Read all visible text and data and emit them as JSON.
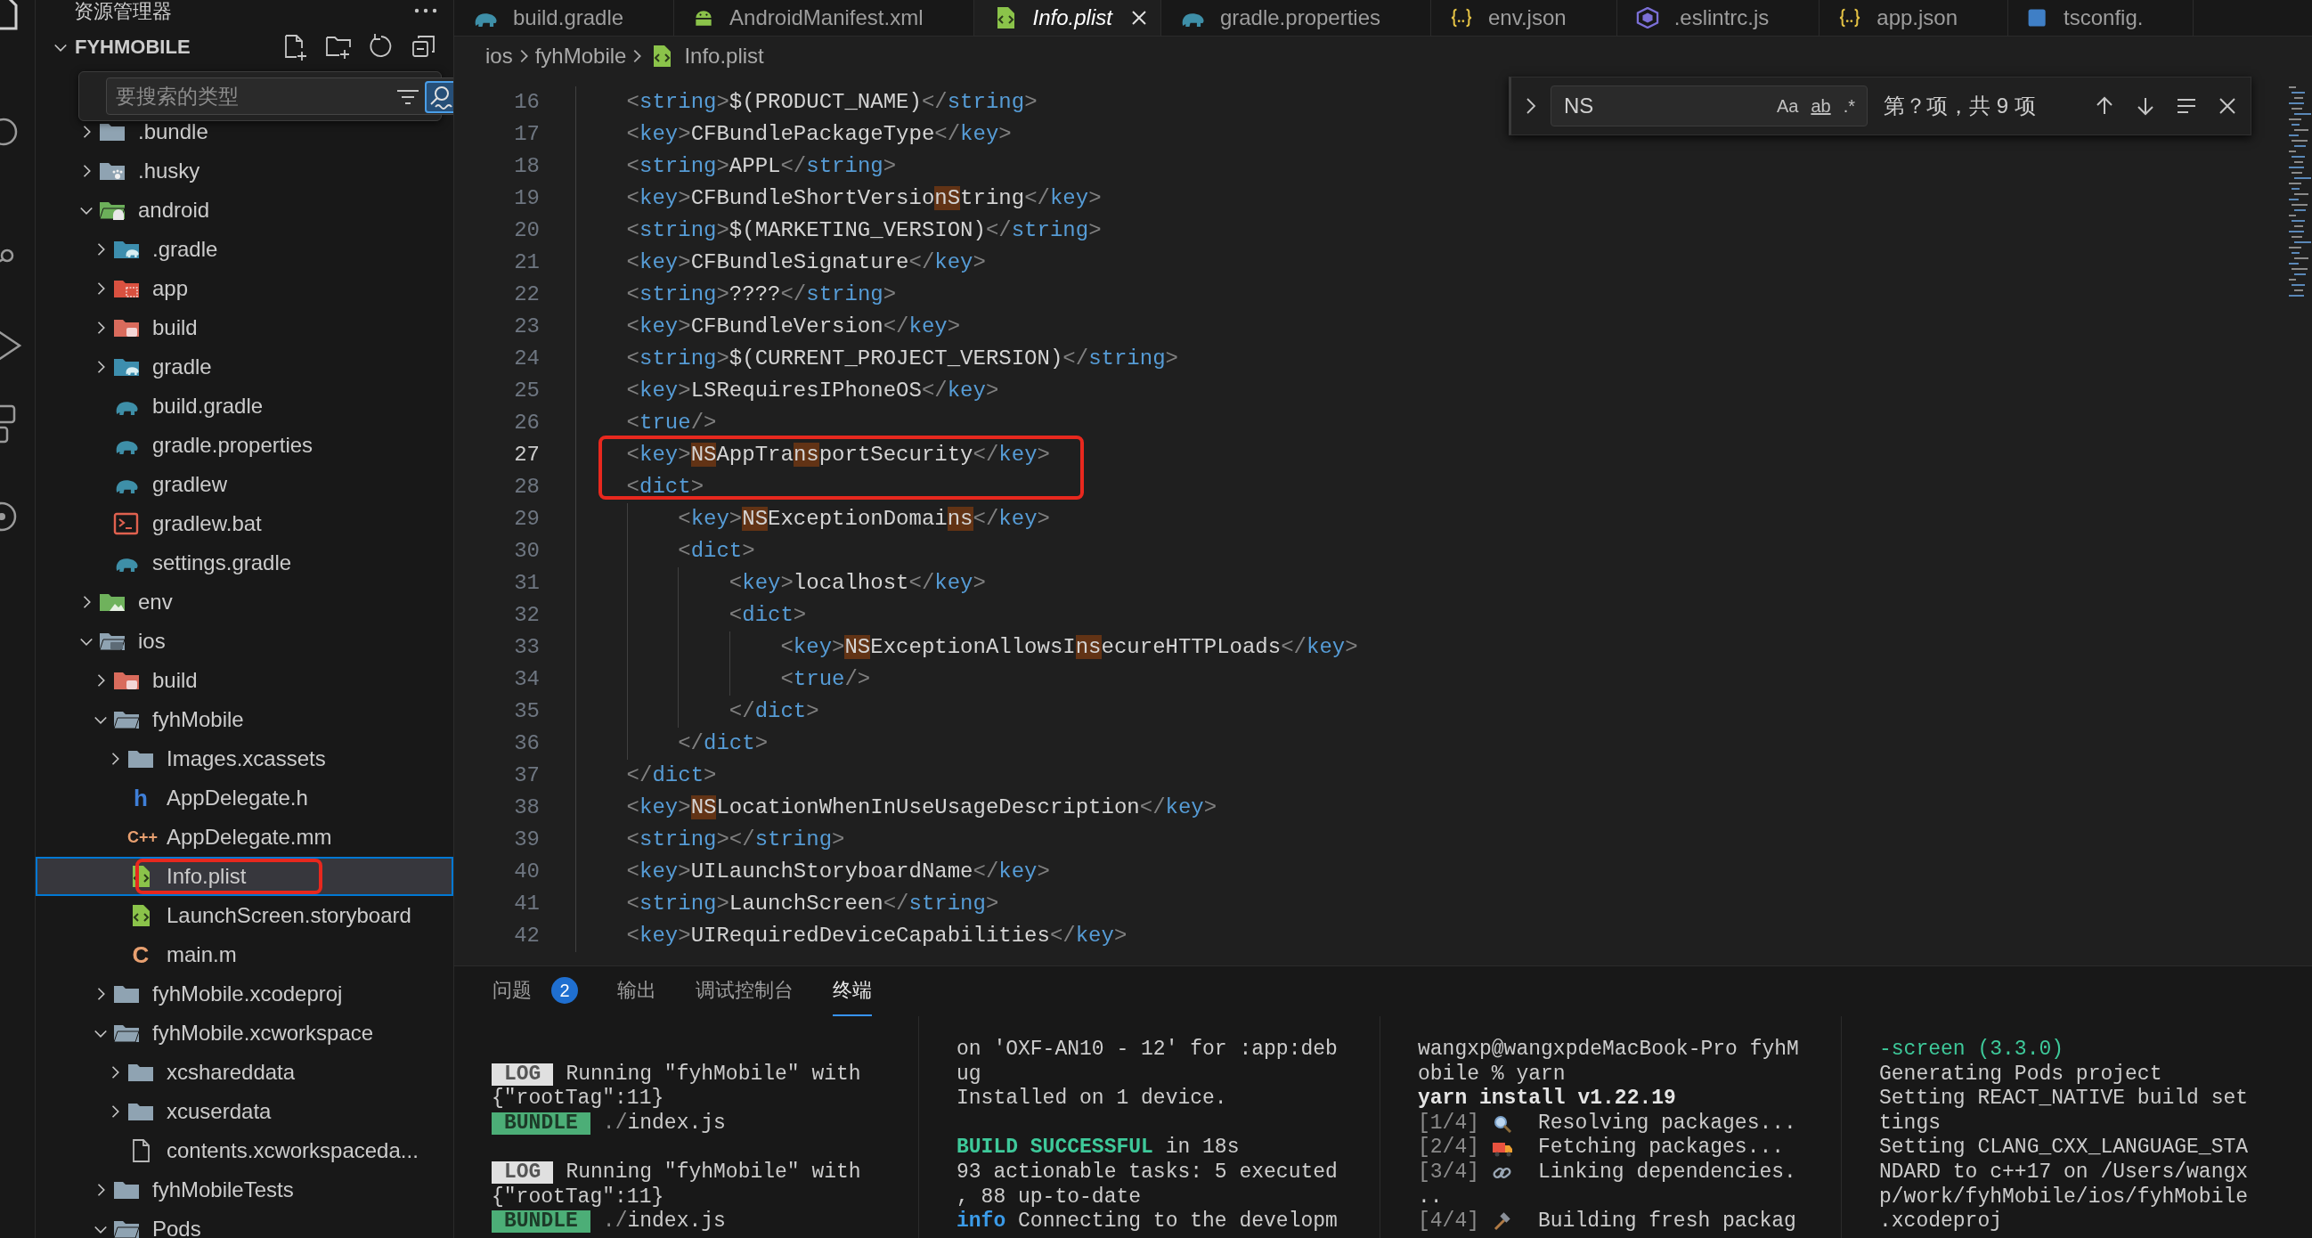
{
  "sidebar": {
    "title": "资源管理器",
    "root": {
      "label": "FYHMOBILE",
      "expanded": true
    },
    "type_filter": {
      "placeholder": "要搜索的类型",
      "fuzzy": true
    },
    "tree": [
      {
        "label": ".bundle",
        "kind": "folder",
        "expanded": false,
        "selected": false,
        "boxed": false
      },
      {
        "label": ".husky",
        "kind": "folder-husky",
        "expanded": false,
        "selected": false,
        "boxed": false
      },
      {
        "label": "android",
        "kind": "folder-android",
        "expanded": true,
        "selected": false,
        "boxed": false,
        "children": [
          {
            "label": ".gradle",
            "kind": "folder-gradle",
            "expanded": false,
            "selected": false,
            "boxed": false
          },
          {
            "label": "app",
            "kind": "folder-app",
            "expanded": false,
            "selected": false,
            "boxed": false
          },
          {
            "label": "build",
            "kind": "folder-build",
            "expanded": false,
            "selected": false,
            "boxed": false
          },
          {
            "label": "gradle",
            "kind": "folder-gradle",
            "expanded": false,
            "selected": false,
            "boxed": false
          },
          {
            "label": "build.gradle",
            "kind": "gradle",
            "selected": false,
            "boxed": false
          },
          {
            "label": "gradle.properties",
            "kind": "gradle",
            "selected": false,
            "boxed": false
          },
          {
            "label": "gradlew",
            "kind": "gradle",
            "selected": false,
            "boxed": false
          },
          {
            "label": "gradlew.bat",
            "kind": "bat",
            "selected": false,
            "boxed": false
          },
          {
            "label": "settings.gradle",
            "kind": "gradle",
            "selected": false,
            "boxed": false
          }
        ]
      },
      {
        "label": "env",
        "kind": "folder-env",
        "expanded": false,
        "selected": false,
        "boxed": false
      },
      {
        "label": "ios",
        "kind": "folder-ios",
        "expanded": true,
        "selected": false,
        "boxed": false,
        "children": [
          {
            "label": "build",
            "kind": "folder-build",
            "expanded": false,
            "selected": false,
            "boxed": false
          },
          {
            "label": "fyhMobile",
            "kind": "folder",
            "expanded": true,
            "selected": false,
            "boxed": false,
            "children": [
              {
                "label": "Images.xcassets",
                "kind": "folder",
                "expanded": false,
                "selected": false,
                "boxed": false
              },
              {
                "label": "AppDelegate.h",
                "kind": "glyph-h",
                "glyph": "h",
                "selected": false,
                "boxed": false
              },
              {
                "label": "AppDelegate.mm",
                "kind": "glyph-cpp",
                "glyph": "C++",
                "selected": false,
                "boxed": false
              },
              {
                "label": "Info.plist",
                "kind": "xml",
                "selected": true,
                "boxed": true
              },
              {
                "label": "LaunchScreen.storyboard",
                "kind": "xml",
                "selected": false,
                "boxed": false
              },
              {
                "label": "main.m",
                "kind": "glyph-c",
                "glyph": "C",
                "selected": false,
                "boxed": false
              }
            ]
          },
          {
            "label": "fyhMobile.xcodeproj",
            "kind": "folder",
            "expanded": false,
            "selected": false,
            "boxed": false
          },
          {
            "label": "fyhMobile.xcworkspace",
            "kind": "folder",
            "expanded": true,
            "selected": false,
            "boxed": false,
            "children": [
              {
                "label": "xcshareddata",
                "kind": "folder",
                "expanded": false,
                "selected": false,
                "boxed": false
              },
              {
                "label": "xcuserdata",
                "kind": "folder",
                "expanded": false,
                "selected": false,
                "boxed": false
              },
              {
                "label": "contents.xcworkspaceda...",
                "kind": "file",
                "selected": false,
                "boxed": false
              }
            ]
          },
          {
            "label": "fyhMobileTests",
            "kind": "folder",
            "expanded": false,
            "selected": false,
            "boxed": false
          },
          {
            "label": "Pods",
            "kind": "folder",
            "expanded": true,
            "selected": false,
            "boxed": false
          }
        ]
      }
    ]
  },
  "tabs": [
    {
      "label": "build.gradle",
      "kind": "gradle",
      "selected": false,
      "preview": false
    },
    {
      "label": "AndroidManifest.xml",
      "kind": "android",
      "selected": false,
      "preview": false
    },
    {
      "label": "Info.plist",
      "kind": "xml",
      "selected": true,
      "preview": true
    },
    {
      "label": "gradle.properties",
      "kind": "gradle",
      "selected": false,
      "preview": false
    },
    {
      "label": "env.json",
      "kind": "json",
      "selected": false,
      "preview": false
    },
    {
      "label": ".eslintrc.js",
      "kind": "eslint",
      "selected": false,
      "preview": false
    },
    {
      "label": "app.json",
      "kind": "json",
      "selected": false,
      "preview": false
    },
    {
      "label": "tsconfig.",
      "kind": "ts",
      "selected": false,
      "preview": false
    }
  ],
  "breadcrumbs": [
    {
      "label": "ios",
      "kind": "folder"
    },
    {
      "label": "fyhMobile",
      "kind": "folder"
    },
    {
      "label": "Info.plist",
      "kind": "xml"
    }
  ],
  "editor": {
    "lines": [
      {
        "number": "16",
        "text": "    <string>$(PRODUCT_NAME)</string>",
        "current": false,
        "boxed": false
      },
      {
        "number": "17",
        "text": "    <key>CFBundlePackageType</key>",
        "current": false,
        "boxed": false
      },
      {
        "number": "18",
        "text": "    <string>APPL</string>",
        "current": false,
        "boxed": false
      },
      {
        "number": "19",
        "text": "    <key>CFBundleShortVersionString</key>",
        "current": false,
        "boxed": false
      },
      {
        "number": "20",
        "text": "    <string>$(MARKETING_VERSION)</string>",
        "current": false,
        "boxed": false
      },
      {
        "number": "21",
        "text": "    <key>CFBundleSignature</key>",
        "current": false,
        "boxed": false
      },
      {
        "number": "22",
        "text": "    <string>????</string>",
        "current": false,
        "boxed": false
      },
      {
        "number": "23",
        "text": "    <key>CFBundleVersion</key>",
        "current": false,
        "boxed": false
      },
      {
        "number": "24",
        "text": "    <string>$(CURRENT_PROJECT_VERSION)</string>",
        "current": false,
        "boxed": false
      },
      {
        "number": "25",
        "text": "    <key>LSRequiresIPhoneOS</key>",
        "current": false,
        "boxed": false
      },
      {
        "number": "26",
        "text": "    <true/>",
        "current": false,
        "boxed": false
      },
      {
        "number": "27",
        "text": "    <key>NSAppTransportSecurity</key>",
        "current": true,
        "boxed": true
      },
      {
        "number": "28",
        "text": "    <dict>",
        "current": false,
        "boxed": true
      },
      {
        "number": "29",
        "text": "        <key>NSExceptionDomains</key>",
        "current": false,
        "boxed": false
      },
      {
        "number": "30",
        "text": "        <dict>",
        "current": false,
        "boxed": false
      },
      {
        "number": "31",
        "text": "            <key>localhost</key>",
        "current": false,
        "boxed": false
      },
      {
        "number": "32",
        "text": "            <dict>",
        "current": false,
        "boxed": false
      },
      {
        "number": "33",
        "text": "                <key>NSExceptionAllowsInsecureHTTPLoads</key>",
        "current": false,
        "boxed": false
      },
      {
        "number": "34",
        "text": "                <true/>",
        "current": false,
        "boxed": false
      },
      {
        "number": "35",
        "text": "            </dict>",
        "current": false,
        "boxed": false
      },
      {
        "number": "36",
        "text": "        </dict>",
        "current": false,
        "boxed": false
      },
      {
        "number": "37",
        "text": "    </dict>",
        "current": false,
        "boxed": false
      },
      {
        "number": "38",
        "text": "    <key>NSLocationWhenInUseUsageDescription</key>",
        "current": false,
        "boxed": false
      },
      {
        "number": "39",
        "text": "    <string></string>",
        "current": false,
        "boxed": false
      },
      {
        "number": "40",
        "text": "    <key>UILaunchStoryboardName</key>",
        "current": false,
        "boxed": false
      },
      {
        "number": "41",
        "text": "    <string>LaunchScreen</string>",
        "current": false,
        "boxed": false
      },
      {
        "number": "42",
        "text": "    <key>UIRequiredDeviceCapabilities</key>",
        "current": false,
        "boxed": false
      }
    ]
  },
  "find": {
    "query": "NS",
    "options": [
      {
        "label": "Aa",
        "active": false
      },
      {
        "label": "ab",
        "active": false
      },
      {
        "label": ".*",
        "active": false
      }
    ],
    "result": "第？项，共 9 项"
  },
  "panel": {
    "tabs": [
      {
        "label": "问题",
        "badge": "2",
        "selected": false
      },
      {
        "label": "输出",
        "selected": false
      },
      {
        "label": "调试控制台",
        "selected": false
      },
      {
        "label": "终端",
        "selected": true
      }
    ],
    "terminals": [
      {
        "lines": [
          {
            "kind": "blank"
          },
          {
            "kind": "text",
            "parts": [
              {
                "kind": "log",
                "text": "LOG"
              },
              {
                "kind": "plain",
                "text": "Running \"fyhMobile\" with"
              }
            ]
          },
          {
            "kind": "text",
            "parts": [
              {
                "kind": "plain",
                "text": "{\"rootTag\":11}"
              }
            ]
          },
          {
            "kind": "text",
            "parts": [
              {
                "kind": "bundle",
                "text": "BUNDLE"
              },
              {
                "kind": "dim",
                "text": "./"
              },
              {
                "kind": "plain",
                "text": "index.js"
              }
            ]
          },
          {
            "kind": "blank"
          },
          {
            "kind": "text",
            "parts": [
              {
                "kind": "log",
                "text": "LOG"
              },
              {
                "kind": "plain",
                "text": "Running \"fyhMobile\" with"
              }
            ]
          },
          {
            "kind": "text",
            "parts": [
              {
                "kind": "plain",
                "text": "{\"rootTag\":11}"
              }
            ]
          },
          {
            "kind": "text",
            "parts": [
              {
                "kind": "bundle",
                "text": "BUNDLE"
              },
              {
                "kind": "dim",
                "text": "./"
              },
              {
                "kind": "plain",
                "text": "index.js"
              }
            ]
          }
        ]
      },
      {
        "lines": [
          {
            "kind": "text",
            "parts": [
              {
                "kind": "plain",
                "text": "on 'OXF-AN10 - 12' for :app:deb"
              }
            ]
          },
          {
            "kind": "text",
            "parts": [
              {
                "kind": "plain",
                "text": "ug"
              }
            ]
          },
          {
            "kind": "text",
            "parts": [
              {
                "kind": "plain",
                "text": "Installed on 1 device."
              }
            ]
          },
          {
            "kind": "blank"
          },
          {
            "kind": "text",
            "parts": [
              {
                "kind": "success",
                "text": "BUILD SUCCESSFUL"
              },
              {
                "kind": "plain",
                "text": " in 18s"
              }
            ]
          },
          {
            "kind": "text",
            "parts": [
              {
                "kind": "plain",
                "text": "93 actionable tasks: 5 executed"
              }
            ]
          },
          {
            "kind": "text",
            "parts": [
              {
                "kind": "plain",
                "text": ", 88 up-to-date"
              }
            ]
          },
          {
            "kind": "text",
            "parts": [
              {
                "kind": "info",
                "text": "info"
              },
              {
                "kind": "plain",
                "text": " Connecting to the developm"
              }
            ]
          }
        ]
      },
      {
        "lines": [
          {
            "kind": "text",
            "parts": [
              {
                "kind": "plain",
                "text": "wangxp@wangxpdeMacBook-Pro fyhM"
              }
            ]
          },
          {
            "kind": "text",
            "parts": [
              {
                "kind": "plain",
                "text": "obile % yarn"
              }
            ]
          },
          {
            "kind": "text",
            "parts": [
              {
                "kind": "bold",
                "text": "yarn install v1.22.19"
              }
            ]
          },
          {
            "kind": "text",
            "parts": [
              {
                "kind": "dim",
                "text": "[1/4]"
              },
              {
                "kind": "step-icon"
              },
              {
                "kind": "plain",
                "text": "Resolving packages..."
              }
            ]
          },
          {
            "kind": "text",
            "parts": [
              {
                "kind": "dim",
                "text": "[2/4]"
              },
              {
                "kind": "step-icon"
              },
              {
                "kind": "plain",
                "text": "Fetching packages..."
              }
            ]
          },
          {
            "kind": "text",
            "parts": [
              {
                "kind": "dim",
                "text": "[3/4]"
              },
              {
                "kind": "step-icon"
              },
              {
                "kind": "plain",
                "text": "Linking dependencies."
              }
            ]
          },
          {
            "kind": "text",
            "parts": [
              {
                "kind": "plain",
                "text": ".."
              }
            ]
          },
          {
            "kind": "text",
            "parts": [
              {
                "kind": "dim",
                "text": "[4/4]"
              },
              {
                "kind": "step-icon"
              },
              {
                "kind": "plain",
                "text": "Building fresh packag"
              }
            ]
          }
        ]
      },
      {
        "lines": [
          {
            "kind": "text",
            "parts": [
              {
                "kind": "green",
                "text": "-screen (3.3.0)"
              }
            ]
          },
          {
            "kind": "text",
            "parts": [
              {
                "kind": "plain",
                "text": "Generating Pods project"
              }
            ]
          },
          {
            "kind": "text",
            "parts": [
              {
                "kind": "plain",
                "text": "Setting REACT_NATIVE build set"
              }
            ]
          },
          {
            "kind": "text",
            "parts": [
              {
                "kind": "plain",
                "text": "tings"
              }
            ]
          },
          {
            "kind": "text",
            "parts": [
              {
                "kind": "plain",
                "text": "Setting CLANG_CXX_LANGUAGE_STA"
              }
            ]
          },
          {
            "kind": "text",
            "parts": [
              {
                "kind": "plain",
                "text": "NDARD to c++17 on /Users/wangx"
              }
            ]
          },
          {
            "kind": "text",
            "parts": [
              {
                "kind": "plain",
                "text": "p/work/fyhMobile/ios/fyhMobile"
              }
            ]
          },
          {
            "kind": "text",
            "parts": [
              {
                "kind": "plain",
                "text": ".xcodeproj"
              }
            ]
          }
        ]
      }
    ]
  }
}
